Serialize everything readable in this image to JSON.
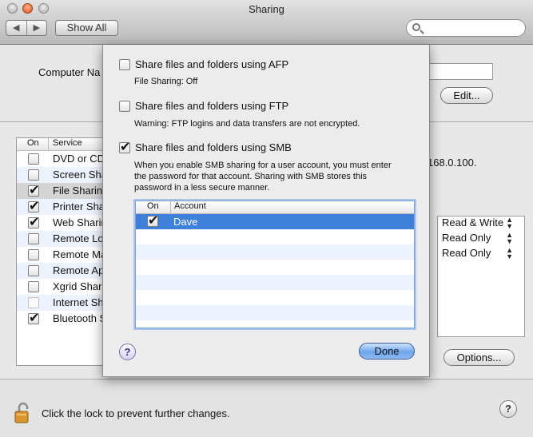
{
  "window": {
    "title": "Sharing"
  },
  "toolbar": {
    "back_glyph": "◀",
    "forward_glyph": "▶",
    "show_all": "Show All",
    "search_placeholder": ""
  },
  "computer": {
    "label": "Computer Na",
    "name_value": "",
    "edit_label": "Edit..."
  },
  "services": {
    "header_on": "On",
    "header_service": "Service",
    "items": [
      {
        "label": "DVD or CD",
        "on": false
      },
      {
        "label": "Screen Sha",
        "on": false
      },
      {
        "label": "File Sharing",
        "on": true
      },
      {
        "label": "Printer Sha",
        "on": true
      },
      {
        "label": "Web Sharin",
        "on": true
      },
      {
        "label": "Remote Lo",
        "on": false
      },
      {
        "label": "Remote Ma",
        "on": false
      },
      {
        "label": "Remote Ap",
        "on": false
      },
      {
        "label": "Xgrid Shari",
        "on": false
      },
      {
        "label": "Internet Sh",
        "on": false
      },
      {
        "label": "Bluetooth S",
        "on": true
      }
    ]
  },
  "address_fragment": "168.0.100.",
  "permissions": [
    "Read & Write",
    "Read Only",
    "Read Only"
  ],
  "options_label": "Options...",
  "lock": {
    "text": "Click the lock to prevent further changes."
  },
  "sheet": {
    "afp": {
      "label": "Share files and folders using AFP",
      "checked": false,
      "note": "File Sharing: Off"
    },
    "ftp": {
      "label": "Share files and folders using FTP",
      "checked": false,
      "note": "Warning: FTP logins and data transfers are not encrypted."
    },
    "smb": {
      "label": "Share files and folders using SMB",
      "checked": true,
      "note_line1": "When you enable SMB sharing for a user account, you must enter",
      "note_line2": "the password for that account. Sharing with SMB stores this",
      "note_line3": "password in a less secure manner."
    },
    "accounts": {
      "header_on": "On",
      "header_account": "Account",
      "rows": [
        {
          "name": "Dave",
          "on": true
        }
      ]
    },
    "help_glyph": "?",
    "done_label": "Done"
  },
  "help_glyph": "?"
}
